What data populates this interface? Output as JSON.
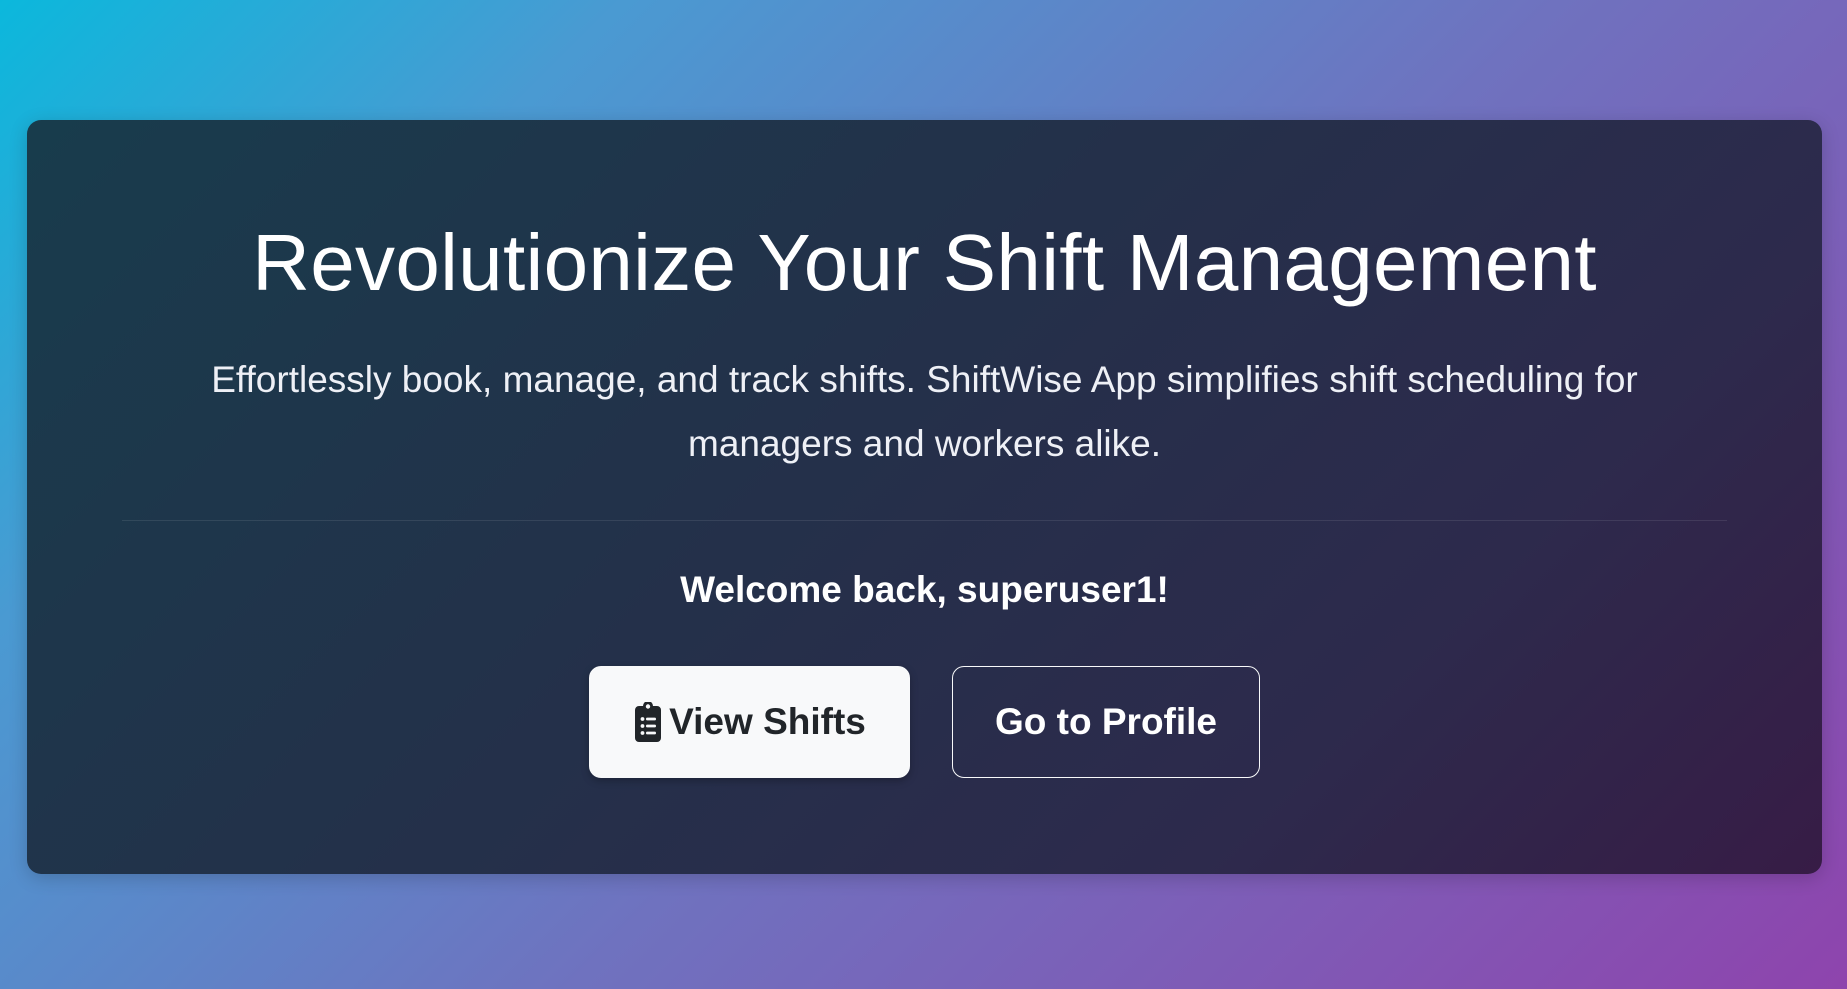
{
  "hero": {
    "title": "Revolutionize Your Shift Management",
    "subtitle": "Effortlessly book, manage, and track shifts. ShiftWise App simplifies shift scheduling for managers and workers alike.",
    "welcome": "Welcome back, superuser1!",
    "buttons": {
      "view_shifts": {
        "label": "View Shifts",
        "icon": "clipboard-list-icon"
      },
      "profile": {
        "label": "Go to Profile"
      }
    }
  },
  "colors": {
    "page_gradient_start": "#0bb8dc",
    "page_gradient_end": "#8e44ad",
    "card_gradient_start": "#183c4c",
    "card_gradient_end": "#371c46",
    "primary_button_bg": "#f8f9fa",
    "primary_button_text": "#212529"
  }
}
